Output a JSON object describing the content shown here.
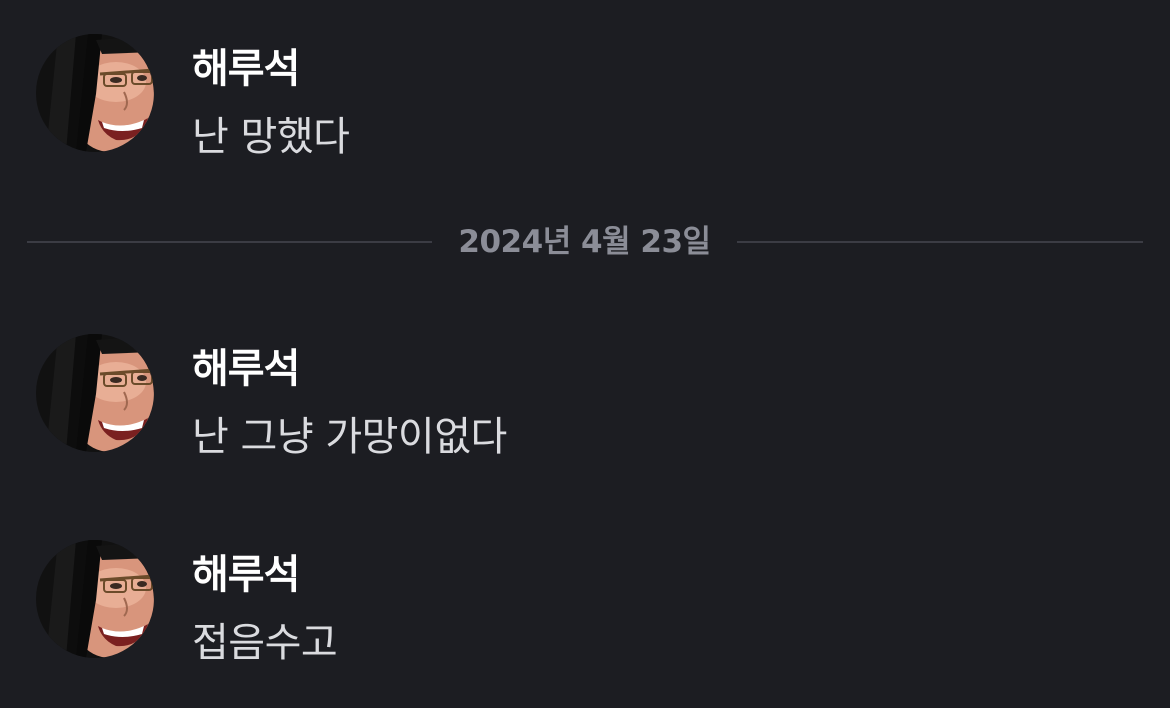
{
  "messages": [
    {
      "author": "해루석",
      "text": "난 망했다",
      "avatar_icon": "user-avatar"
    },
    {
      "author": "해루석",
      "text": "난 그냥 가망이없다",
      "avatar_icon": "user-avatar"
    },
    {
      "author": "해루석",
      "text": "접음수고",
      "avatar_icon": "user-avatar"
    }
  ],
  "date_divider": {
    "label": "2024년 4월 23일"
  },
  "colors": {
    "background": "#1c1d22",
    "author": "#ffffff",
    "message_text": "#dadbdf",
    "divider_text": "#8b8d97",
    "divider_line": "#3b3c44"
  }
}
